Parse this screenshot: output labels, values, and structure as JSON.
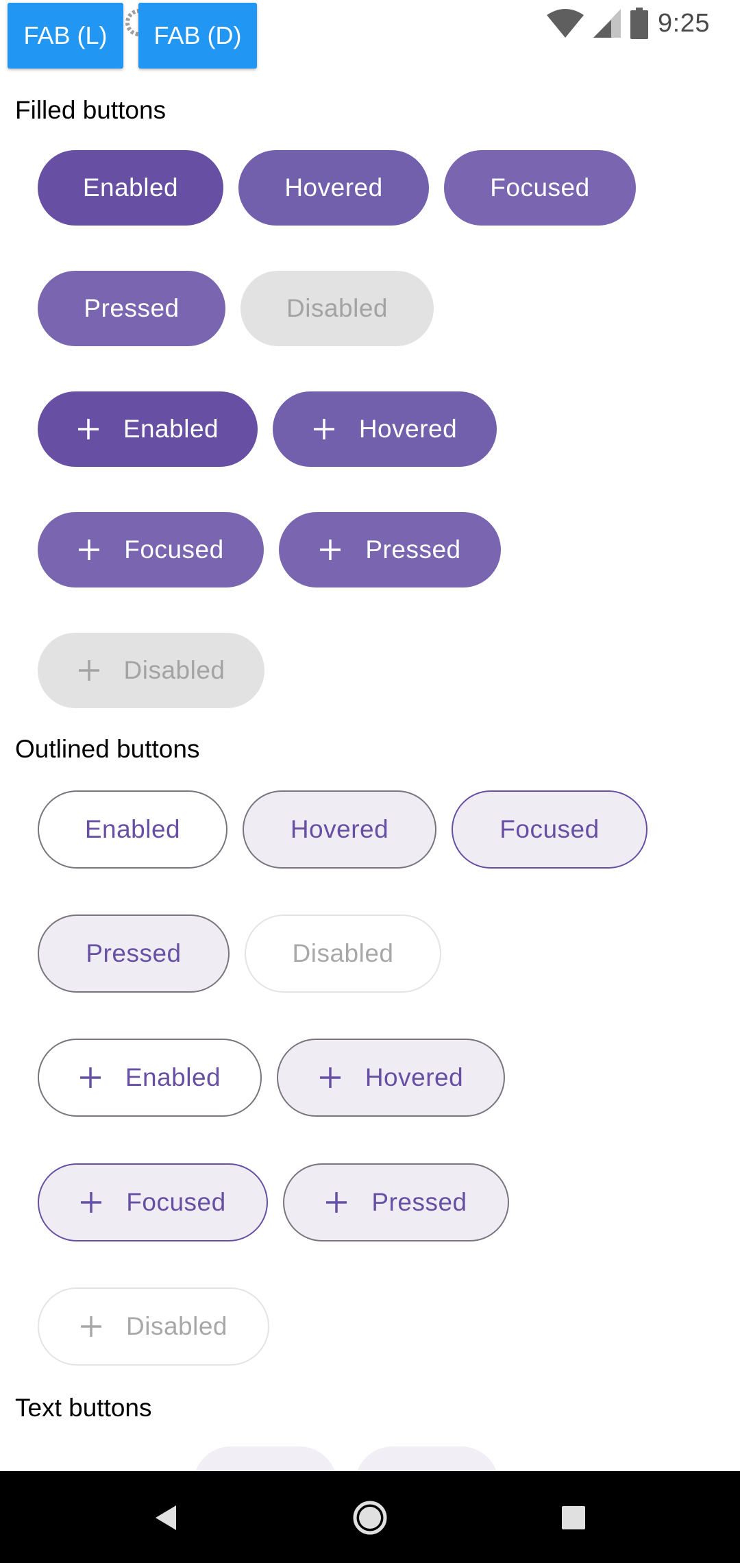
{
  "status_bar": {
    "time": "9:25",
    "left_icons": [
      "app-notification-icon",
      "sd-card-icon",
      "loading-icon"
    ],
    "right_icons": [
      "wifi-icon",
      "cell-signal-icon",
      "battery-icon"
    ]
  },
  "debug_buttons": {
    "fab_light": "FAB (L)",
    "fab_dark": "FAB (D)"
  },
  "sections": {
    "filled": "Filled buttons",
    "outlined": "Outlined buttons",
    "text": "Text buttons"
  },
  "filled_buttons": {
    "enabled": "Enabled",
    "hovered": "Hovered",
    "focused": "Focused",
    "pressed": "Pressed",
    "disabled": "Disabled",
    "icon_enabled": "Enabled",
    "icon_hovered": "Hovered",
    "icon_focused": "Focused",
    "icon_pressed": "Pressed",
    "icon_disabled": "Disabled"
  },
  "outlined_buttons": {
    "enabled": "Enabled",
    "hovered": "Hovered",
    "focused": "Focused",
    "pressed": "Pressed",
    "disabled": "Disabled",
    "icon_enabled": "Enabled",
    "icon_hovered": "Hovered",
    "icon_focused": "Focused",
    "icon_pressed": "Pressed",
    "icon_disabled": "Disabled"
  },
  "colors": {
    "primary": "#6750a4",
    "fab_blue": "#2196f3",
    "disabled_bg": "#e2e2e2",
    "outline": "#79747e"
  },
  "nav_bar": {
    "icons": [
      "back-icon",
      "home-icon",
      "recents-icon"
    ]
  }
}
